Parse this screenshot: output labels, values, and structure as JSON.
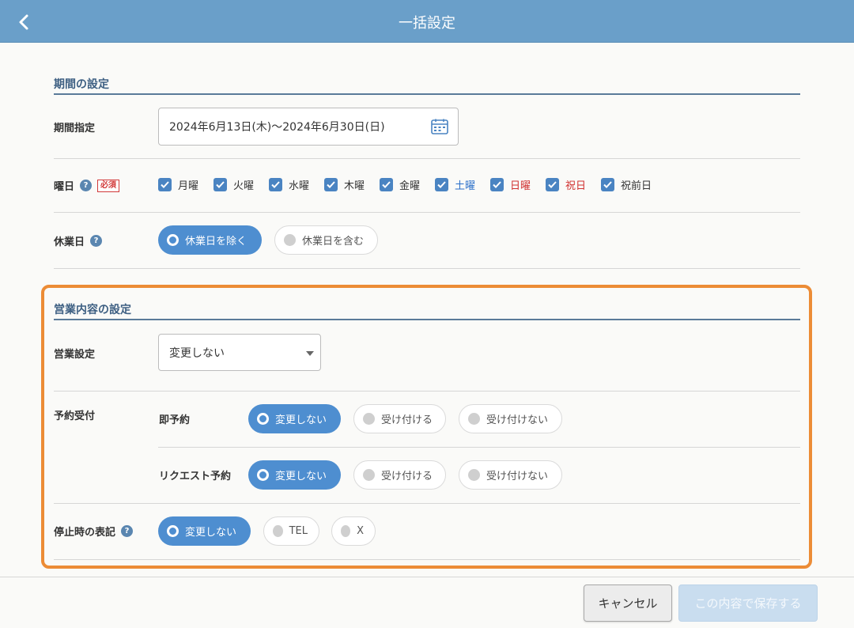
{
  "header": {
    "title": "一括設定"
  },
  "period_section": {
    "title": "期間の設定",
    "period_label": "期間指定",
    "period_value": "2024年6月13日(木)〜2024年6月30日(日)",
    "weekday_label": "曜日",
    "required_badge": "必須",
    "weekdays": [
      {
        "label": "月曜",
        "checked": true,
        "color": "#333333"
      },
      {
        "label": "火曜",
        "checked": true,
        "color": "#333333"
      },
      {
        "label": "水曜",
        "checked": true,
        "color": "#333333"
      },
      {
        "label": "木曜",
        "checked": true,
        "color": "#333333"
      },
      {
        "label": "金曜",
        "checked": true,
        "color": "#333333"
      },
      {
        "label": "土曜",
        "checked": true,
        "color": "#2a6fc9"
      },
      {
        "label": "日曜",
        "checked": true,
        "color": "#d0302f"
      },
      {
        "label": "祝日",
        "checked": true,
        "color": "#d0302f"
      },
      {
        "label": "祝前日",
        "checked": true,
        "color": "#333333"
      }
    ],
    "holiday_label": "休業日",
    "holiday_options": [
      "休業日を除く",
      "休業日を含む"
    ],
    "holiday_selected": "休業日を除く"
  },
  "business_section": {
    "title": "営業内容の設定",
    "business_setting_label": "営業設定",
    "business_setting_value": "変更しない",
    "reservation_label": "予約受付",
    "instant_label": "即予約",
    "instant_options": [
      "変更しない",
      "受け付ける",
      "受け付けない"
    ],
    "instant_selected": "変更しない",
    "request_label": "リクエスト予約",
    "request_options": [
      "変更しない",
      "受け付ける",
      "受け付けない"
    ],
    "request_selected": "変更しない",
    "stop_label": "停止時の表記",
    "stop_options": [
      "変更しない",
      "TEL",
      "X"
    ],
    "stop_selected": "変更しない"
  },
  "footer": {
    "cancel_label": "キャンセル",
    "save_label": "この内容で保存する"
  },
  "icons": {
    "back": "chevron-left-icon",
    "calendar": "calendar-icon",
    "help": "help-icon",
    "dropdown": "chevron-down-icon"
  },
  "colors": {
    "header": "#6a9fc9",
    "accent": "#4e8ed0",
    "highlight": "#ec8c36",
    "required": "#d23a3a"
  }
}
